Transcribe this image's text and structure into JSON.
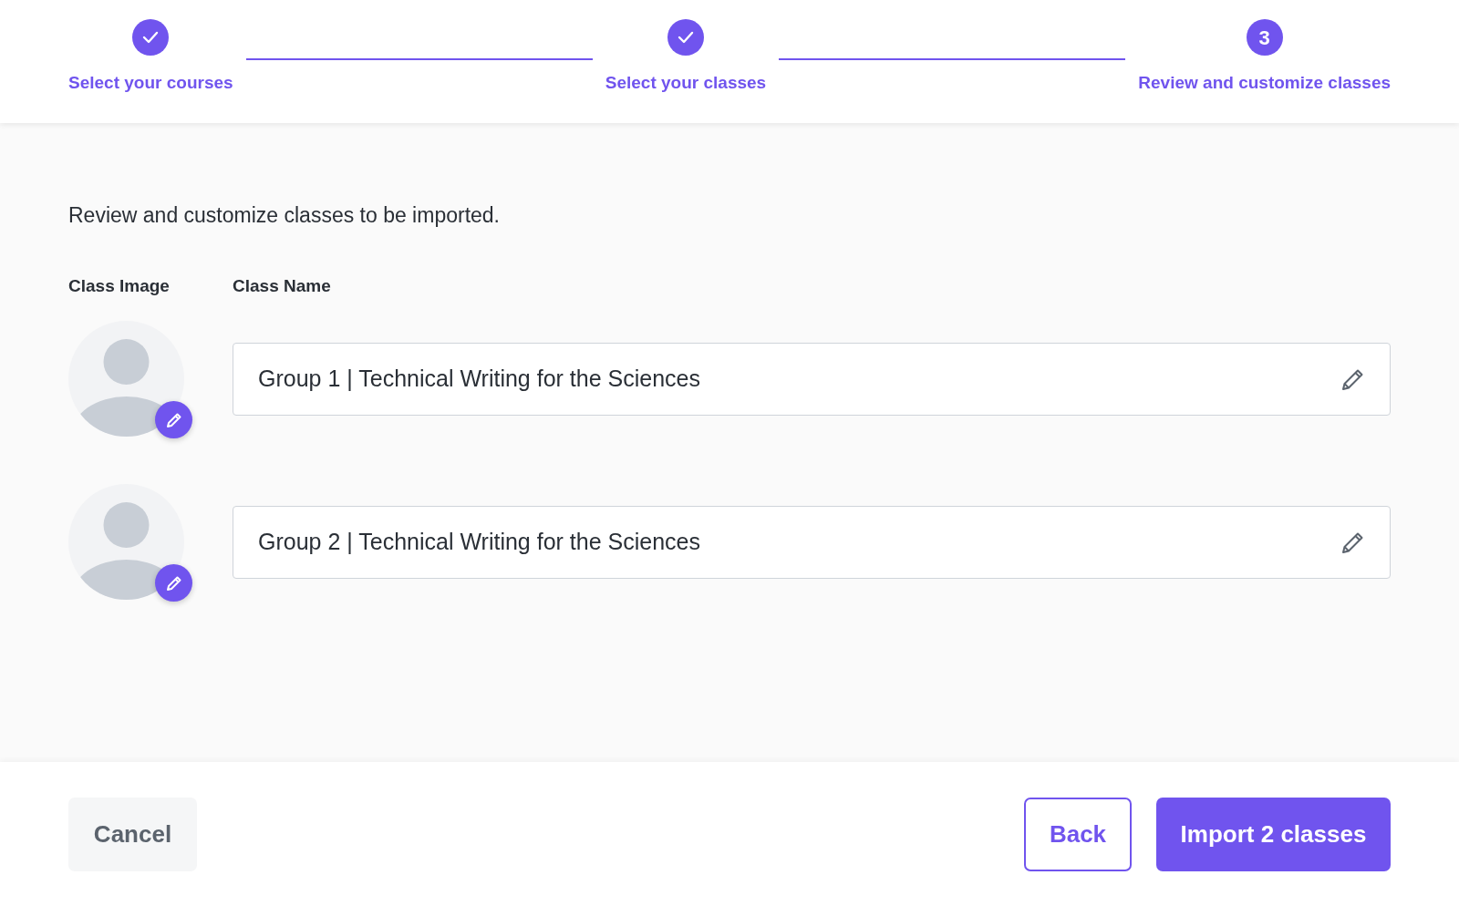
{
  "steps": [
    {
      "label": "Select your courses",
      "kind": "done"
    },
    {
      "label": "Select your classes",
      "kind": "done"
    },
    {
      "label": "Review and customize classes",
      "kind": "current",
      "number": "3"
    }
  ],
  "intro": "Review and customize classes to be imported.",
  "columns": [
    "Class Image",
    "Class Name"
  ],
  "classes": [
    {
      "name": "Group 1 | Technical Writing for the Sciences"
    },
    {
      "name": "Group 2 | Technical Writing for the Sciences"
    }
  ],
  "buttons": {
    "cancel": "Cancel",
    "back": "Back",
    "import": "Import 2 classes"
  }
}
